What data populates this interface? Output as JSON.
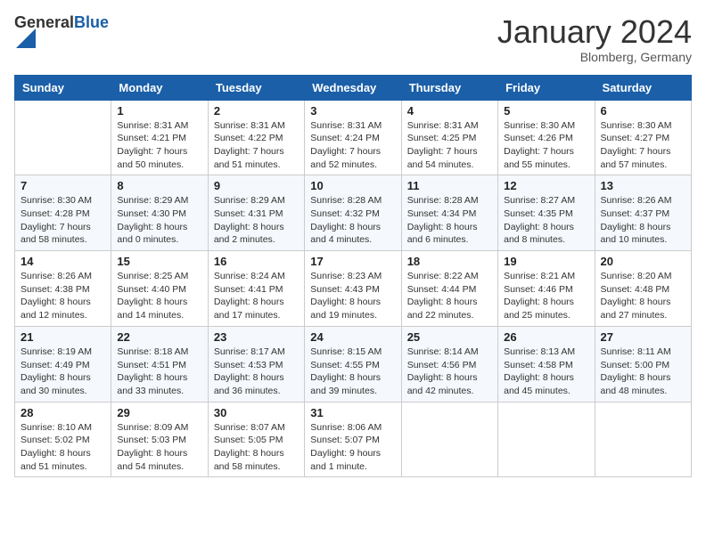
{
  "logo": {
    "general": "General",
    "blue": "Blue"
  },
  "header": {
    "month": "January 2024",
    "location": "Blomberg, Germany"
  },
  "weekdays": [
    "Sunday",
    "Monday",
    "Tuesday",
    "Wednesday",
    "Thursday",
    "Friday",
    "Saturday"
  ],
  "weeks": [
    [
      {
        "day": "",
        "sunrise": "",
        "sunset": "",
        "daylight": ""
      },
      {
        "day": "1",
        "sunrise": "Sunrise: 8:31 AM",
        "sunset": "Sunset: 4:21 PM",
        "daylight": "Daylight: 7 hours and 50 minutes."
      },
      {
        "day": "2",
        "sunrise": "Sunrise: 8:31 AM",
        "sunset": "Sunset: 4:22 PM",
        "daylight": "Daylight: 7 hours and 51 minutes."
      },
      {
        "day": "3",
        "sunrise": "Sunrise: 8:31 AM",
        "sunset": "Sunset: 4:24 PM",
        "daylight": "Daylight: 7 hours and 52 minutes."
      },
      {
        "day": "4",
        "sunrise": "Sunrise: 8:31 AM",
        "sunset": "Sunset: 4:25 PM",
        "daylight": "Daylight: 7 hours and 54 minutes."
      },
      {
        "day": "5",
        "sunrise": "Sunrise: 8:30 AM",
        "sunset": "Sunset: 4:26 PM",
        "daylight": "Daylight: 7 hours and 55 minutes."
      },
      {
        "day": "6",
        "sunrise": "Sunrise: 8:30 AM",
        "sunset": "Sunset: 4:27 PM",
        "daylight": "Daylight: 7 hours and 57 minutes."
      }
    ],
    [
      {
        "day": "7",
        "sunrise": "Sunrise: 8:30 AM",
        "sunset": "Sunset: 4:28 PM",
        "daylight": "Daylight: 7 hours and 58 minutes."
      },
      {
        "day": "8",
        "sunrise": "Sunrise: 8:29 AM",
        "sunset": "Sunset: 4:30 PM",
        "daylight": "Daylight: 8 hours and 0 minutes."
      },
      {
        "day": "9",
        "sunrise": "Sunrise: 8:29 AM",
        "sunset": "Sunset: 4:31 PM",
        "daylight": "Daylight: 8 hours and 2 minutes."
      },
      {
        "day": "10",
        "sunrise": "Sunrise: 8:28 AM",
        "sunset": "Sunset: 4:32 PM",
        "daylight": "Daylight: 8 hours and 4 minutes."
      },
      {
        "day": "11",
        "sunrise": "Sunrise: 8:28 AM",
        "sunset": "Sunset: 4:34 PM",
        "daylight": "Daylight: 8 hours and 6 minutes."
      },
      {
        "day": "12",
        "sunrise": "Sunrise: 8:27 AM",
        "sunset": "Sunset: 4:35 PM",
        "daylight": "Daylight: 8 hours and 8 minutes."
      },
      {
        "day": "13",
        "sunrise": "Sunrise: 8:26 AM",
        "sunset": "Sunset: 4:37 PM",
        "daylight": "Daylight: 8 hours and 10 minutes."
      }
    ],
    [
      {
        "day": "14",
        "sunrise": "Sunrise: 8:26 AM",
        "sunset": "Sunset: 4:38 PM",
        "daylight": "Daylight: 8 hours and 12 minutes."
      },
      {
        "day": "15",
        "sunrise": "Sunrise: 8:25 AM",
        "sunset": "Sunset: 4:40 PM",
        "daylight": "Daylight: 8 hours and 14 minutes."
      },
      {
        "day": "16",
        "sunrise": "Sunrise: 8:24 AM",
        "sunset": "Sunset: 4:41 PM",
        "daylight": "Daylight: 8 hours and 17 minutes."
      },
      {
        "day": "17",
        "sunrise": "Sunrise: 8:23 AM",
        "sunset": "Sunset: 4:43 PM",
        "daylight": "Daylight: 8 hours and 19 minutes."
      },
      {
        "day": "18",
        "sunrise": "Sunrise: 8:22 AM",
        "sunset": "Sunset: 4:44 PM",
        "daylight": "Daylight: 8 hours and 22 minutes."
      },
      {
        "day": "19",
        "sunrise": "Sunrise: 8:21 AM",
        "sunset": "Sunset: 4:46 PM",
        "daylight": "Daylight: 8 hours and 25 minutes."
      },
      {
        "day": "20",
        "sunrise": "Sunrise: 8:20 AM",
        "sunset": "Sunset: 4:48 PM",
        "daylight": "Daylight: 8 hours and 27 minutes."
      }
    ],
    [
      {
        "day": "21",
        "sunrise": "Sunrise: 8:19 AM",
        "sunset": "Sunset: 4:49 PM",
        "daylight": "Daylight: 8 hours and 30 minutes."
      },
      {
        "day": "22",
        "sunrise": "Sunrise: 8:18 AM",
        "sunset": "Sunset: 4:51 PM",
        "daylight": "Daylight: 8 hours and 33 minutes."
      },
      {
        "day": "23",
        "sunrise": "Sunrise: 8:17 AM",
        "sunset": "Sunset: 4:53 PM",
        "daylight": "Daylight: 8 hours and 36 minutes."
      },
      {
        "day": "24",
        "sunrise": "Sunrise: 8:15 AM",
        "sunset": "Sunset: 4:55 PM",
        "daylight": "Daylight: 8 hours and 39 minutes."
      },
      {
        "day": "25",
        "sunrise": "Sunrise: 8:14 AM",
        "sunset": "Sunset: 4:56 PM",
        "daylight": "Daylight: 8 hours and 42 minutes."
      },
      {
        "day": "26",
        "sunrise": "Sunrise: 8:13 AM",
        "sunset": "Sunset: 4:58 PM",
        "daylight": "Daylight: 8 hours and 45 minutes."
      },
      {
        "day": "27",
        "sunrise": "Sunrise: 8:11 AM",
        "sunset": "Sunset: 5:00 PM",
        "daylight": "Daylight: 8 hours and 48 minutes."
      }
    ],
    [
      {
        "day": "28",
        "sunrise": "Sunrise: 8:10 AM",
        "sunset": "Sunset: 5:02 PM",
        "daylight": "Daylight: 8 hours and 51 minutes."
      },
      {
        "day": "29",
        "sunrise": "Sunrise: 8:09 AM",
        "sunset": "Sunset: 5:03 PM",
        "daylight": "Daylight: 8 hours and 54 minutes."
      },
      {
        "day": "30",
        "sunrise": "Sunrise: 8:07 AM",
        "sunset": "Sunset: 5:05 PM",
        "daylight": "Daylight: 8 hours and 58 minutes."
      },
      {
        "day": "31",
        "sunrise": "Sunrise: 8:06 AM",
        "sunset": "Sunset: 5:07 PM",
        "daylight": "Daylight: 9 hours and 1 minute."
      },
      {
        "day": "",
        "sunrise": "",
        "sunset": "",
        "daylight": ""
      },
      {
        "day": "",
        "sunrise": "",
        "sunset": "",
        "daylight": ""
      },
      {
        "day": "",
        "sunrise": "",
        "sunset": "",
        "daylight": ""
      }
    ]
  ]
}
